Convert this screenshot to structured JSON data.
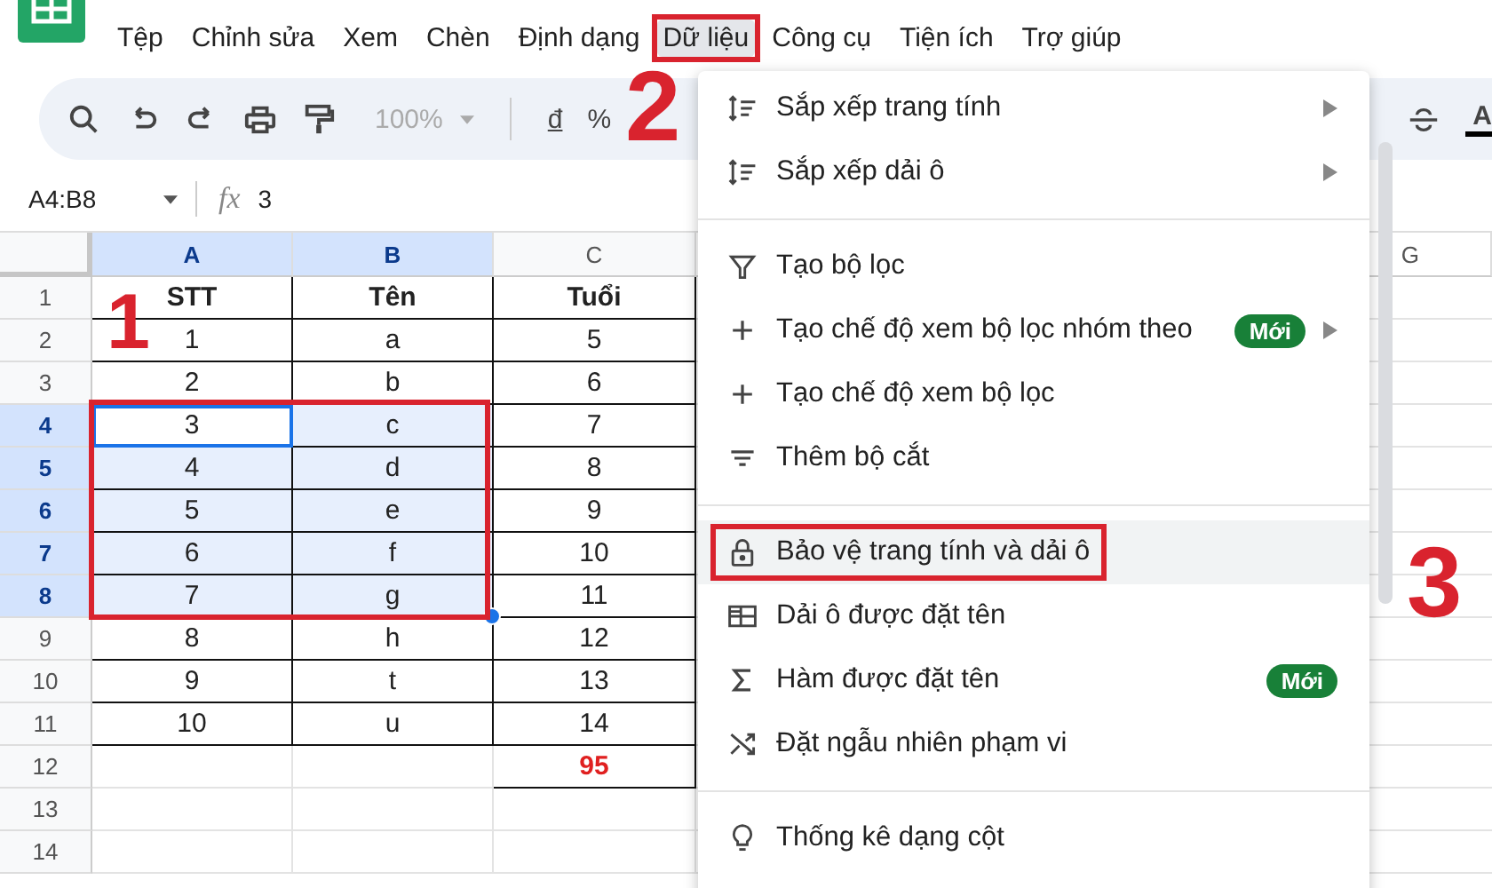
{
  "menu_bar": [
    {
      "label": "Tệp",
      "selected": false
    },
    {
      "label": "Chỉnh sửa",
      "selected": false
    },
    {
      "label": "Xem",
      "selected": false
    },
    {
      "label": "Chèn",
      "selected": false
    },
    {
      "label": "Định dạng",
      "selected": false
    },
    {
      "label": "Dữ liệu",
      "selected": true
    },
    {
      "label": "Công cụ",
      "selected": false
    },
    {
      "label": "Tiện ích",
      "selected": false
    },
    {
      "label": "Trợ giúp",
      "selected": false
    }
  ],
  "toolbar": {
    "zoom": "100%",
    "currency": "đ",
    "percent": "%",
    "text_color": "A"
  },
  "formula_bar": {
    "name_box": "A4:B8",
    "fx": "fx",
    "value": "3"
  },
  "columns": [
    {
      "label": "A",
      "selected": true
    },
    {
      "label": "B",
      "selected": true
    },
    {
      "label": "C",
      "selected": false
    }
  ],
  "far_column": {
    "label": "G"
  },
  "rows": [
    {
      "number": "1",
      "selected": false,
      "cells": [
        {
          "kind": "header",
          "text": "STT"
        },
        {
          "kind": "header",
          "text": "Tên"
        },
        {
          "kind": "header",
          "text": "Tuổi"
        }
      ]
    },
    {
      "number": "2",
      "selected": false,
      "cells": [
        {
          "kind": "plain",
          "text": "1"
        },
        {
          "kind": "plain",
          "text": "a"
        },
        {
          "kind": "plain",
          "text": "5"
        }
      ]
    },
    {
      "number": "3",
      "selected": false,
      "cells": [
        {
          "kind": "plain",
          "text": "2"
        },
        {
          "kind": "plain",
          "text": "b"
        },
        {
          "kind": "plain",
          "text": "6"
        }
      ]
    },
    {
      "number": "4",
      "selected": true,
      "cells": [
        {
          "kind": "plain",
          "text": "3"
        },
        {
          "kind": "plain",
          "text": "c"
        },
        {
          "kind": "plain",
          "text": "7"
        }
      ]
    },
    {
      "number": "5",
      "selected": true,
      "cells": [
        {
          "kind": "plain",
          "text": "4"
        },
        {
          "kind": "plain",
          "text": "d"
        },
        {
          "kind": "plain",
          "text": "8"
        }
      ]
    },
    {
      "number": "6",
      "selected": true,
      "cells": [
        {
          "kind": "plain",
          "text": "5"
        },
        {
          "kind": "plain",
          "text": "e"
        },
        {
          "kind": "plain",
          "text": "9"
        }
      ]
    },
    {
      "number": "7",
      "selected": true,
      "cells": [
        {
          "kind": "plain",
          "text": "6"
        },
        {
          "kind": "plain",
          "text": "f"
        },
        {
          "kind": "plain",
          "text": "10"
        }
      ]
    },
    {
      "number": "8",
      "selected": true,
      "cells": [
        {
          "kind": "plain",
          "text": "7"
        },
        {
          "kind": "plain",
          "text": "g"
        },
        {
          "kind": "plain",
          "text": "11"
        }
      ]
    },
    {
      "number": "9",
      "selected": false,
      "cells": [
        {
          "kind": "plain",
          "text": "8"
        },
        {
          "kind": "plain",
          "text": "h"
        },
        {
          "kind": "plain",
          "text": "12"
        }
      ]
    },
    {
      "number": "10",
      "selected": false,
      "cells": [
        {
          "kind": "plain",
          "text": "9"
        },
        {
          "kind": "plain",
          "text": "t"
        },
        {
          "kind": "plain",
          "text": "13"
        }
      ]
    },
    {
      "number": "11",
      "selected": false,
      "cells": [
        {
          "kind": "plain",
          "text": "10"
        },
        {
          "kind": "plain",
          "text": "u"
        },
        {
          "kind": "plain",
          "text": "14"
        }
      ]
    },
    {
      "number": "12",
      "selected": false,
      "cells": [
        {
          "kind": "blank"
        },
        {
          "kind": "blank"
        },
        {
          "kind": "total",
          "text": "95"
        }
      ]
    },
    {
      "number": "13",
      "selected": false,
      "cells": [
        {
          "kind": "blank"
        },
        {
          "kind": "blank"
        },
        {
          "kind": "blank"
        }
      ]
    },
    {
      "number": "14",
      "selected": false,
      "cells": [
        {
          "kind": "blank"
        },
        {
          "kind": "blank"
        },
        {
          "kind": "blank"
        }
      ]
    }
  ],
  "data_menu": [
    {
      "kind": "item",
      "label": "Sắp xếp trang tính",
      "submenu": true,
      "selected": false
    },
    {
      "kind": "item",
      "label": "Sắp xếp dải ô",
      "submenu": true,
      "selected": false
    },
    {
      "kind": "divider"
    },
    {
      "kind": "item",
      "label": "Tạo bộ lọc",
      "submenu": false,
      "selected": false
    },
    {
      "kind": "item",
      "label": "Tạo chế độ xem bộ lọc nhóm theo",
      "badge": "Mới",
      "submenu": true,
      "selected": false
    },
    {
      "kind": "item",
      "label": "Tạo chế độ xem bộ lọc",
      "submenu": false,
      "selected": false
    },
    {
      "kind": "item",
      "label": "Thêm bộ cắt",
      "submenu": false,
      "selected": false
    },
    {
      "kind": "divider"
    },
    {
      "kind": "item",
      "label": "Bảo vệ trang tính và dải ô",
      "submenu": false,
      "selected": true
    },
    {
      "kind": "item",
      "label": "Dải ô được đặt tên",
      "submenu": false,
      "selected": false
    },
    {
      "kind": "item",
      "label": "Hàm được đặt tên",
      "badge": "Mới",
      "submenu": false,
      "selected": false
    },
    {
      "kind": "item",
      "label": "Đặt ngẫu nhiên phạm vi",
      "submenu": false,
      "selected": false
    },
    {
      "kind": "divider"
    },
    {
      "kind": "item",
      "label": "Thống kê dạng cột",
      "submenu": false,
      "selected": false
    }
  ],
  "annotations": [
    "1",
    "2",
    "3"
  ]
}
